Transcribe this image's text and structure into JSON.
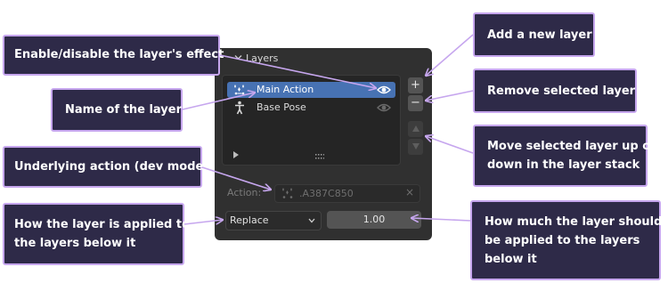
{
  "panel": {
    "title": "Layers",
    "layers": [
      {
        "label": "Main Action",
        "selected": true
      },
      {
        "label": "Base Pose",
        "selected": false
      }
    ],
    "side_buttons": {
      "add": "+",
      "remove": "−"
    },
    "action_label": "Action:",
    "action_value": ".A387C850",
    "action_clear": "×",
    "blend_mode": "Replace",
    "influence": "1.00"
  },
  "annotations": {
    "enable": "Enable/disable the layer's effect",
    "name": "Name of the layer",
    "underlying": "Underlying action (dev mode)",
    "how_applied": [
      "How the layer is applied to",
      "the layers below it"
    ],
    "add": "Add a new layer",
    "remove": "Remove selected layer",
    "move": [
      "Move selected layer up or",
      "down in the layer stack"
    ],
    "how_much": [
      "How much the layer should",
      "be applied to the layers",
      "below it"
    ]
  },
  "colors": {
    "panel_bg": "#303030",
    "selection": "#4772b3",
    "callout_bg": "#2e2a48",
    "callout_border": "#c6a6ee"
  }
}
